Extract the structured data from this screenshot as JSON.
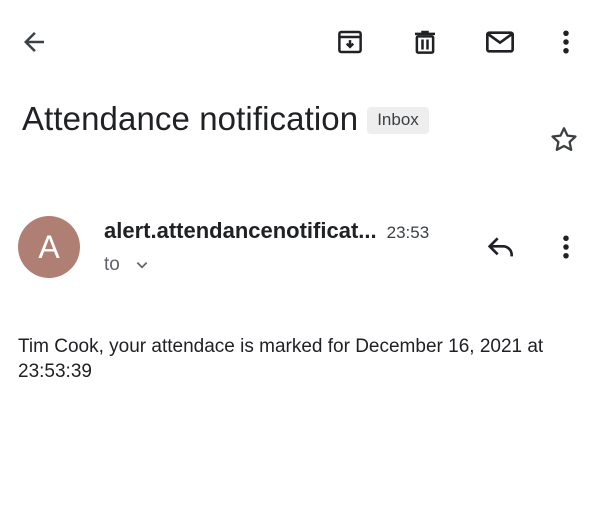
{
  "toolbar": {
    "back_icon": "arrow-left-icon",
    "archive_icon": "archive-icon",
    "delete_icon": "trash-icon",
    "mark_unread_icon": "mail-icon",
    "more_icon": "more-vert-icon"
  },
  "email": {
    "subject": "Attendance notification",
    "label": "Inbox",
    "star_icon": "star-outline-icon",
    "sender": {
      "avatar_letter": "A",
      "avatar_color": "#b07f74",
      "name": "alert.attendancenotificat...",
      "time": "23:53"
    },
    "recipients_label": "to",
    "reply_icon": "reply-icon",
    "more_icon": "more-vert-icon",
    "body": "Tim Cook, your attendace is marked for December 16, 2021 at 23:53:39"
  }
}
